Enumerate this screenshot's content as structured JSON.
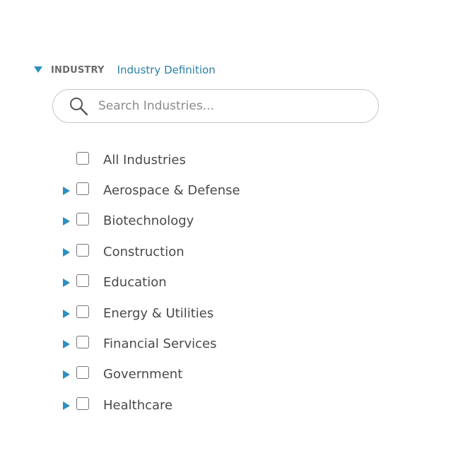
{
  "filter": {
    "section_title": "INDUSTRY",
    "definition_link": "Industry Definition",
    "expanded": true
  },
  "search": {
    "placeholder": "Search Industries...",
    "value": ""
  },
  "colors": {
    "accent": "#2b8fc2",
    "link": "#2b7fa3"
  },
  "items": [
    {
      "label": "All Industries",
      "expandable": false,
      "checked": false
    },
    {
      "label": "Aerospace & Defense",
      "expandable": true,
      "checked": false
    },
    {
      "label": "Biotechnology",
      "expandable": true,
      "checked": false
    },
    {
      "label": "Construction",
      "expandable": true,
      "checked": false
    },
    {
      "label": "Education",
      "expandable": true,
      "checked": false
    },
    {
      "label": "Energy & Utilities",
      "expandable": true,
      "checked": false
    },
    {
      "label": "Financial Services",
      "expandable": true,
      "checked": false
    },
    {
      "label": "Government",
      "expandable": true,
      "checked": false
    },
    {
      "label": "Healthcare",
      "expandable": true,
      "checked": false
    }
  ]
}
